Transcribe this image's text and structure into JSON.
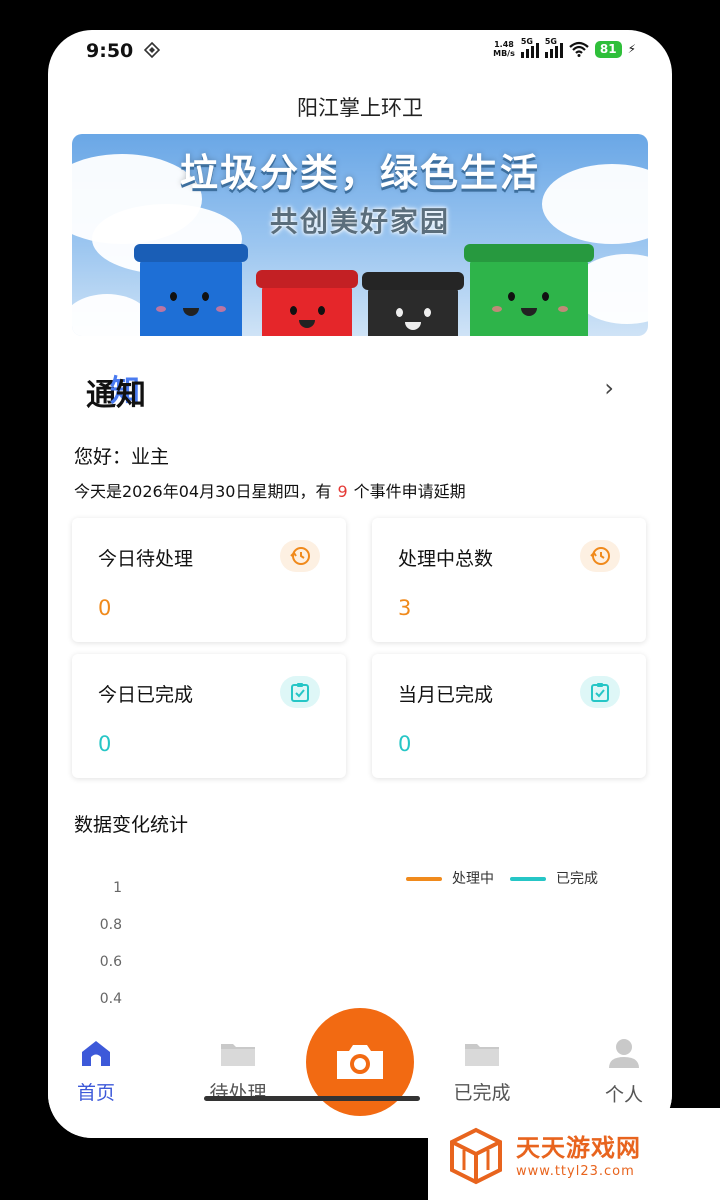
{
  "status_bar": {
    "time": "9:50",
    "net_speed_value": "1.48",
    "net_speed_unit": "MB/s",
    "signal1_label": "5G",
    "signal2_label": "5G",
    "battery": "81"
  },
  "app": {
    "title": "阳江掌上环卫"
  },
  "banner": {
    "headline": "垃圾分类，绿色生活",
    "subline": "共创美好家园",
    "bin_colors": [
      "#1e6fd6",
      "#e5262a",
      "#2b2b2b",
      "#2eb44a"
    ]
  },
  "notice": {
    "title_part1": "通",
    "title_part2": "知",
    "chevron": "›"
  },
  "greeting": {
    "text": "您好：业主",
    "today_prefix": "今天是2026年04月30日星期四，有",
    "today_count": "9",
    "today_suffix": "个事件申请延期"
  },
  "stats": [
    {
      "label": "今日待处理",
      "value": "0",
      "icon": "history-icon"
    },
    {
      "label": "处理中总数",
      "value": "3",
      "icon": "history-icon"
    },
    {
      "label": "今日已完成",
      "value": "0",
      "icon": "clipboard-check-icon"
    },
    {
      "label": "当月已完成",
      "value": "0",
      "icon": "clipboard-check-icon"
    }
  ],
  "chart_section": {
    "title": "数据变化统计"
  },
  "chart_data": {
    "type": "line",
    "series": [
      {
        "name": "处理中",
        "color": "#f08a1c",
        "values": []
      },
      {
        "name": "已完成",
        "color": "#26c6c6",
        "values": []
      }
    ],
    "yticks": [
      "1",
      "0.8",
      "0.6",
      "0.4"
    ],
    "ylim": [
      0,
      1
    ],
    "legend": "top-right"
  },
  "bottom_nav": {
    "items": [
      {
        "label": "首页",
        "icon": "home-icon",
        "active": true
      },
      {
        "label": "待处理",
        "icon": "folder-icon",
        "active": false
      },
      {
        "label": "已完成",
        "icon": "folder-icon",
        "active": false
      },
      {
        "label": "个人",
        "icon": "person-icon",
        "active": false
      }
    ],
    "center_icon": "camera-icon"
  },
  "watermark": {
    "title": "天天游戏网",
    "url": "www.ttyl23.com"
  }
}
